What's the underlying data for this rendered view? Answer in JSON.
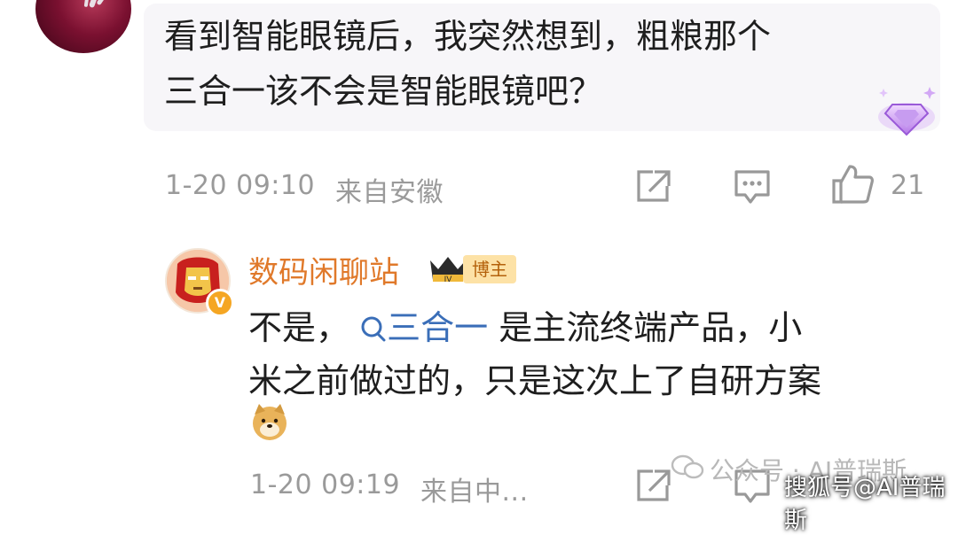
{
  "comment": {
    "line1": "看到智能眼镜后，我突然想到，粗粮那个",
    "line2": "三合一该不会是智能眼镜吧？",
    "time": "1-20 09:10",
    "location": "来自安徽",
    "likes": "21"
  },
  "reply": {
    "username": "数码闲聊站",
    "level": "IV",
    "tag": "博主",
    "prefix": "不是，",
    "link_text": "三合一",
    "suffix": "是主流终端产品，小",
    "line2": "米之前做过的，只是这次上了自研方案",
    "time": "1-20 09:19",
    "location": "来自中..."
  },
  "watermark": {
    "text": "公众号 · AI普瑞斯",
    "sohu": "搜狐号@AI普瑞斯"
  },
  "colors": {
    "bubble": "#f7f6f9",
    "username": "#e0792a",
    "link": "#3a6eb8",
    "meta": "#9a9a9a"
  },
  "icons": [
    "share-icon",
    "comment-icon",
    "thumbs-up-icon",
    "gem-badge-icon",
    "search-icon",
    "doge-emoji-icon",
    "wechat-icon"
  ]
}
